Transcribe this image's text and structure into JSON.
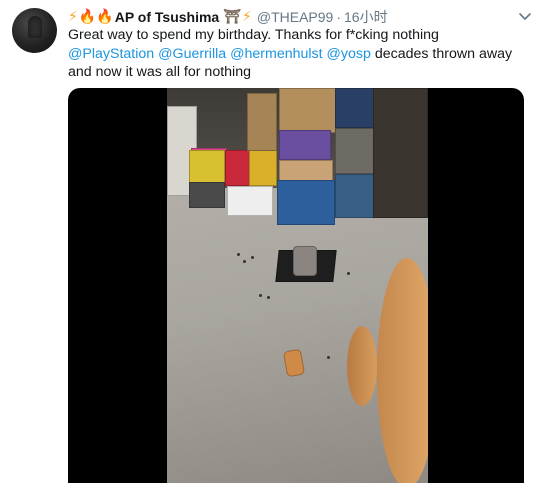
{
  "tweet": {
    "author": {
      "emojis_before": [
        "⚡",
        "🔥🔥"
      ],
      "name": "AP of Tsushima",
      "emojis_after": [
        "⛩",
        "⚡"
      ],
      "handle": "@THEAP99",
      "time": "16小时"
    },
    "text": {
      "line1": "Great way to spend my birthday. Thanks for f*cking nothing",
      "mentions": [
        "@PlayStation",
        "@Guerrilla",
        "@hermenhulst",
        "@yosp"
      ],
      "after_mentions": " decades thrown away",
      "line3": "and now it was all for nothing"
    },
    "icons": {
      "more": "chevron-down-icon",
      "avatar": "user-avatar"
    },
    "media": {
      "type": "video"
    }
  },
  "colors": {
    "link": "#1b95e0",
    "secondary": "#657786",
    "text": "#14171a"
  }
}
